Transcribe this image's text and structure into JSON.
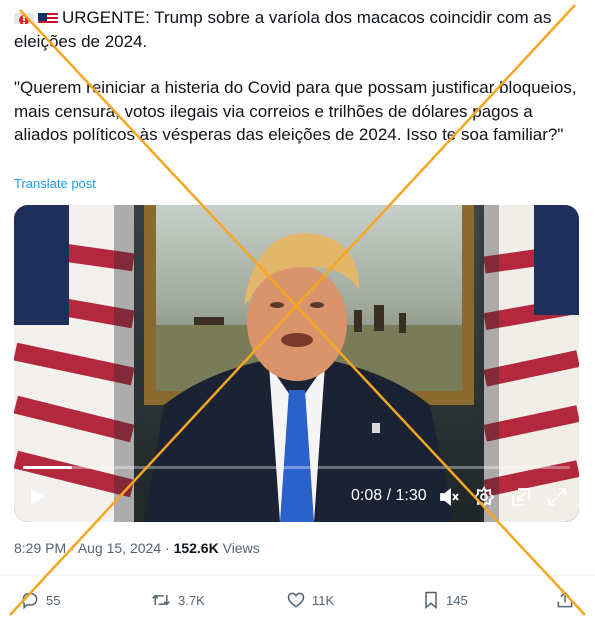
{
  "tweet": {
    "flags": [
      "flag-alert-icon",
      "us-flag-icon"
    ],
    "line1": "URGENTE: Trump sobre a varíola dos macacos coincidir com as eleições de 2024.",
    "quote": "\"Querem reiniciar a histeria do Covid para que possam justificar bloqueios, mais censura, votos ilegais via correios e trilhões de dólares pagos a aliados políticos às vésperas das eleições de 2024. Isso te soa familiar?\"",
    "translate_label": "Translate post"
  },
  "video": {
    "current_time": "0:08",
    "separator": " / ",
    "duration": "1:30",
    "progress_fraction": 0.089,
    "icons": [
      "play-icon",
      "mute-icon",
      "settings-icon",
      "pip-icon",
      "fullscreen-icon"
    ]
  },
  "meta": {
    "time": "8:29 PM",
    "dot1": " · ",
    "date": "Aug 15, 2024",
    "dot2": " · ",
    "views_count": "152.6K",
    "views_label": " Views"
  },
  "actions": {
    "replies": "55",
    "reposts": "3.7K",
    "likes": "11K",
    "bookmarks": "145"
  },
  "colors": {
    "accent": "#1d9bf0",
    "text": "#0f1419",
    "muted": "#536471",
    "cross": "#f5a623"
  }
}
